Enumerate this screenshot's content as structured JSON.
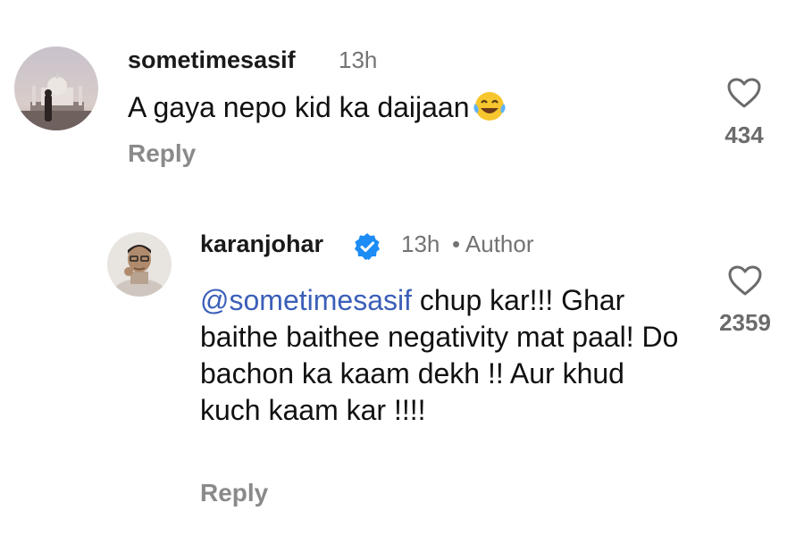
{
  "comments": [
    {
      "username": "sometimesasif",
      "time": "13h",
      "text": "A gaya nepo kid ka daijaan",
      "emoji_icon": "laughing-tears-emoji",
      "reply_label": "Reply",
      "like_count": "434",
      "like_icon": "heart-outline-icon"
    }
  ],
  "reply": {
    "username": "karanjohar",
    "verified_icon": "verified-badge-icon",
    "time": "13h",
    "separator": "•",
    "author_label": "Author",
    "mention": "@sometimesasif",
    "text": " chup kar!!! Ghar baithe baithee negativity mat paal! Do bachon ka kaam dekh !! Aur khud kuch kaam kar !!!!",
    "reply_label": "Reply",
    "like_count": "2359",
    "like_icon": "heart-outline-icon"
  },
  "colors": {
    "mention": "#3b5fb8",
    "verified": "#1d8cf5",
    "muted": "#737373",
    "emoji_face": "#f7c62f"
  }
}
